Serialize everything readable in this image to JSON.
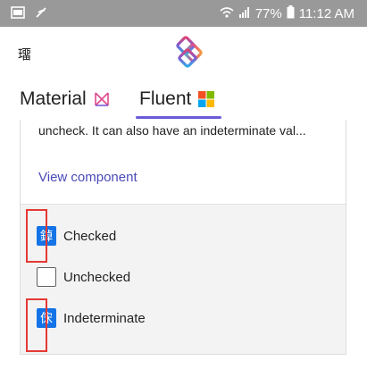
{
  "status_bar": {
    "battery": "77%",
    "time": "11:12 AM"
  },
  "app_bar": {
    "left_glyph": "璢"
  },
  "tabs": [
    {
      "label": "Material"
    },
    {
      "label": "Fluent"
    }
  ],
  "card": {
    "description": "uncheck. It can also have an indeterminate val...",
    "view_link": "View component"
  },
  "checkboxes": [
    {
      "glyph": "鋽",
      "label": "Checked",
      "state": "checked"
    },
    {
      "glyph": "",
      "label": "Unchecked",
      "state": "unchecked"
    },
    {
      "glyph": "俕",
      "label": "Indeterminate",
      "state": "indeterminate"
    }
  ],
  "colors": {
    "accent": "#6b5bd6",
    "checkbox_fill": "#1473e6",
    "highlight": "#e53935",
    "link": "#4a4ab8"
  }
}
